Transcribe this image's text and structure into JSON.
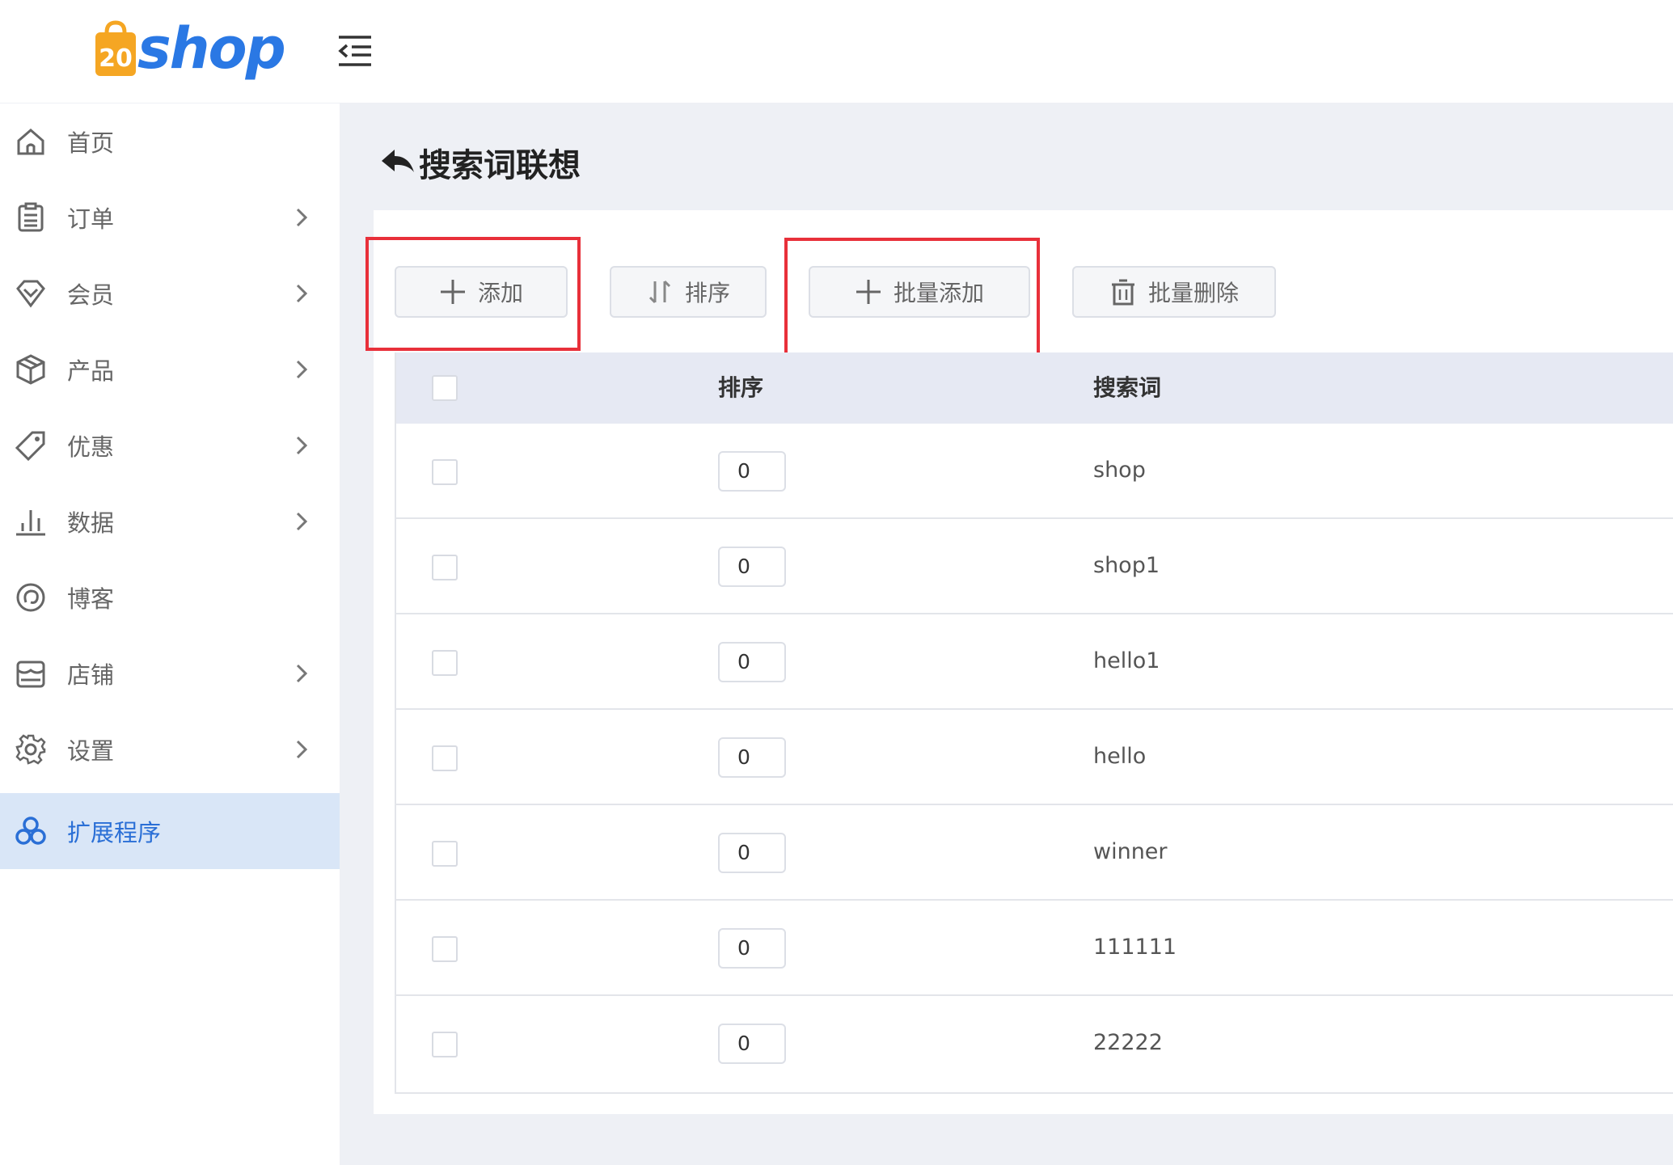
{
  "app": {
    "logo_text": "shop",
    "logo_badge_text": "20"
  },
  "sidebar": {
    "items": [
      {
        "label": "首页",
        "icon": "home-icon",
        "has_children": false
      },
      {
        "label": "订单",
        "icon": "clipboard-icon",
        "has_children": true
      },
      {
        "label": "会员",
        "icon": "diamond-icon",
        "has_children": true
      },
      {
        "label": "产品",
        "icon": "box-icon",
        "has_children": true
      },
      {
        "label": "优惠",
        "icon": "tag-icon",
        "has_children": true
      },
      {
        "label": "数据",
        "icon": "bar-chart-icon",
        "has_children": true
      },
      {
        "label": "博客",
        "icon": "swirl-icon",
        "has_children": false
      },
      {
        "label": "店铺",
        "icon": "store-icon",
        "has_children": true
      },
      {
        "label": "设置",
        "icon": "gear-icon",
        "has_children": true
      },
      {
        "label": "扩展程序",
        "icon": "extension-icon",
        "has_children": false,
        "active": true
      }
    ]
  },
  "page": {
    "title": "搜索词联想"
  },
  "toolbar": {
    "add_label": "添加",
    "sort_label": "排序",
    "batch_add_label": "批量添加",
    "batch_delete_label": "批量删除"
  },
  "table": {
    "columns": {
      "sort": "排序",
      "keyword": "搜索词"
    },
    "rows": [
      {
        "sort": "0",
        "keyword": "shop"
      },
      {
        "sort": "0",
        "keyword": "shop1"
      },
      {
        "sort": "0",
        "keyword": "hello1"
      },
      {
        "sort": "0",
        "keyword": "hello"
      },
      {
        "sort": "0",
        "keyword": "winner"
      },
      {
        "sort": "0",
        "keyword": "111111"
      },
      {
        "sort": "0",
        "keyword": "22222"
      }
    ]
  },
  "colors": {
    "accent": "#2a6fd6",
    "highlight": "#e8303a",
    "active_bg": "#d9e6f7",
    "logo_orange": "#f5a623"
  }
}
